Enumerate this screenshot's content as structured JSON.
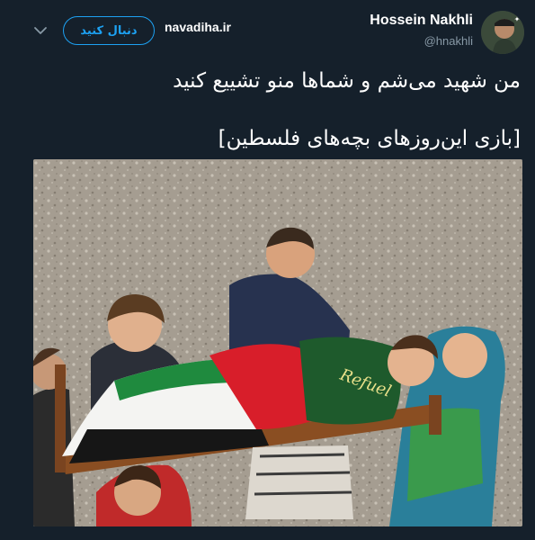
{
  "header": {
    "display_name": "Hossein Nakhli",
    "handle": "@hnakhli",
    "follow_label": "دنبال کنید",
    "watermark": "navadiha.ir",
    "avatar_icon": "user-avatar-photo",
    "menu_icon": "chevron-down-icon"
  },
  "tweet": {
    "line1": "من شهید می‌شم و شماها منو تشییع کنید",
    "line2": "[بازی این‌روزهای بچه‌های فلسطین]"
  },
  "photo": {
    "flag_text": "Refuel"
  },
  "colors": {
    "background": "#15202b",
    "accent": "#1da1f2",
    "secondary_text": "#8899a6"
  }
}
